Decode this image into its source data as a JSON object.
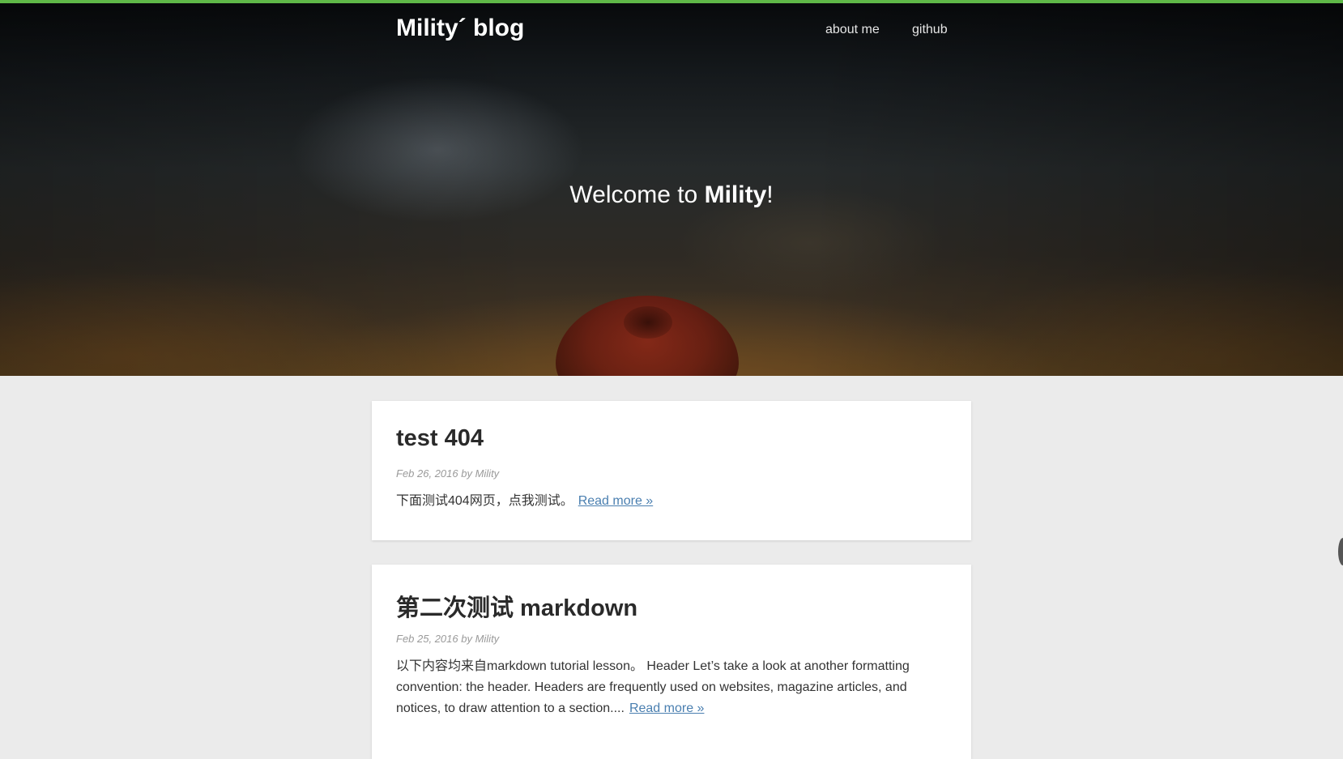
{
  "colors": {
    "accent_bar": "#5fb848",
    "page_background": "#ebebeb",
    "link": "#4a7fb0"
  },
  "nav": {
    "brand": "Mility´ blog",
    "links": [
      {
        "label": "about me"
      },
      {
        "label": "github"
      }
    ]
  },
  "hero": {
    "welcome_prefix": "Welcome to ",
    "welcome_name": "Mility",
    "welcome_suffix": "!"
  },
  "posts": [
    {
      "title": "test 404",
      "meta": "Feb 26, 2016 by Mility",
      "excerpt": "下面测试404网页，点我测试。",
      "read_more": "Read more »"
    },
    {
      "title": "第二次测试 markdown",
      "meta": "Feb 25, 2016 by Mility",
      "excerpt": "以下内容均来自markdown tutorial lesson。 Header Let’s take a look at another formatting convention: the header. Headers are frequently used on websites, magazine articles, and notices, to draw attention to a section....",
      "read_more": "Read more »"
    }
  ]
}
